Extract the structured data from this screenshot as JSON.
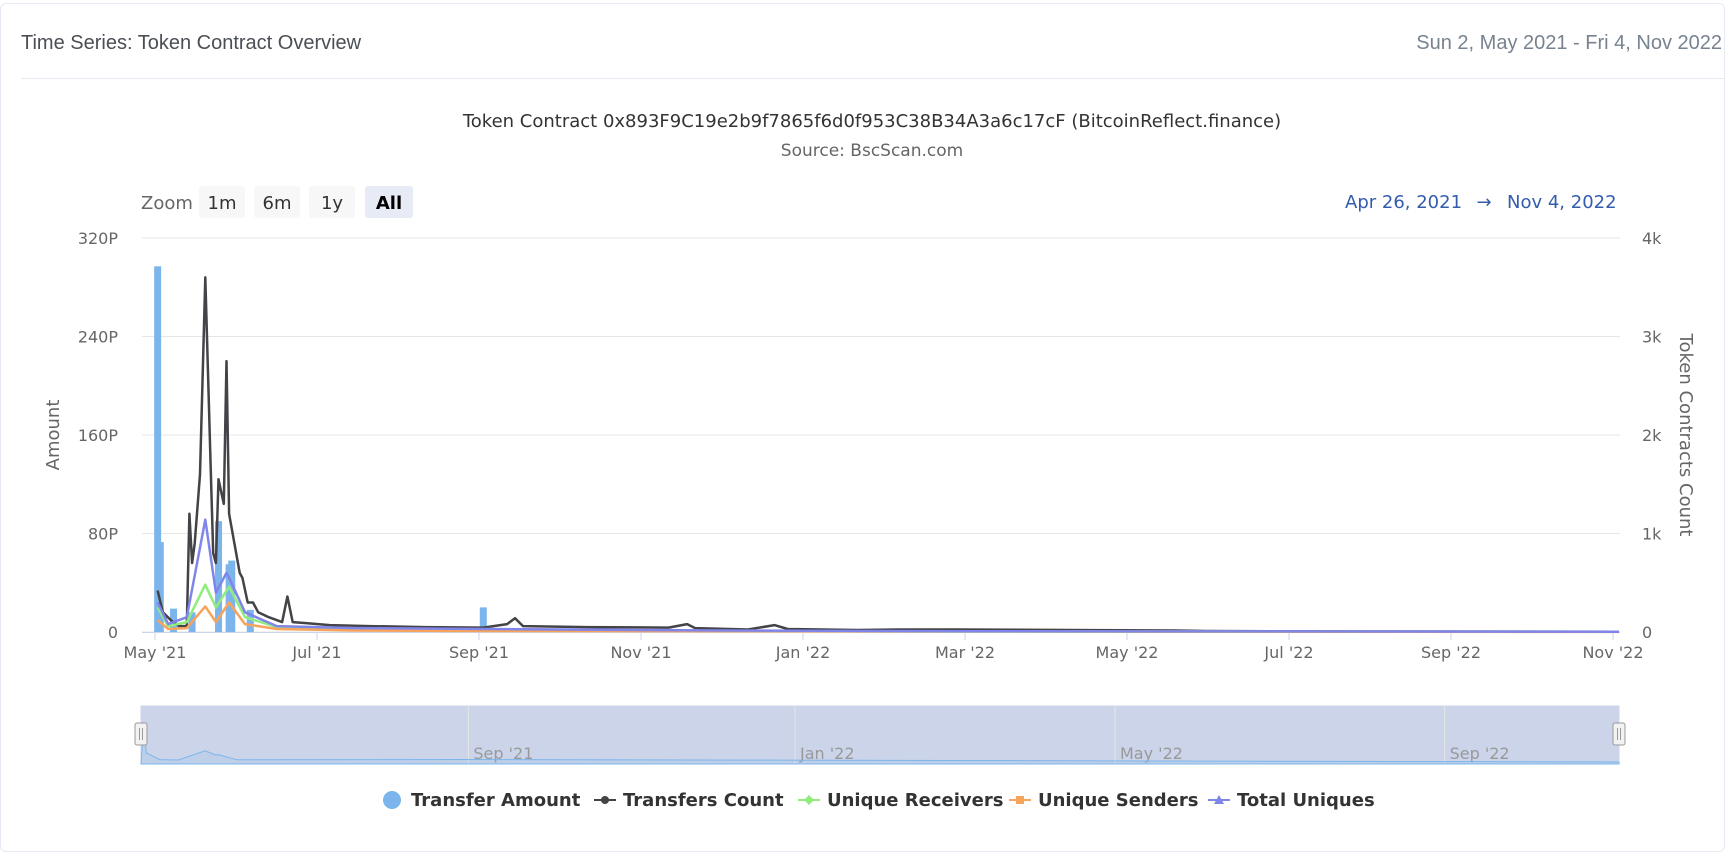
{
  "header": {
    "title": "Time Series: Token Contract Overview",
    "date_range": "Sun 2, May 2021 - Fri 4, Nov 2022"
  },
  "zoom": {
    "label": "Zoom",
    "buttons": [
      "1m",
      "6m",
      "1y",
      "All"
    ],
    "selected": "All",
    "from": "Apr 26, 2021",
    "arrow": "→",
    "to": "Nov 4, 2022"
  },
  "chart_data": {
    "type": "line",
    "title": "Token Contract 0x893F9C19e2b9f7865f6d0f953C38B34A3a6c17cF (BitcoinReflect.finance)",
    "subtitle": "Source: BscScan.com",
    "x_range": [
      "2021-04-30",
      "2022-11-04"
    ],
    "x_ticks": [
      "May '21",
      "Jul '21",
      "Sep '21",
      "Nov '21",
      "Jan '22",
      "Mar '22",
      "May '22",
      "Jul '22",
      "Sep '22",
      "Nov '22"
    ],
    "y_left": {
      "label": "Amount",
      "ticks": [
        "0",
        "80P",
        "160P",
        "240P",
        "320P"
      ],
      "range": [
        0,
        320
      ]
    },
    "y_right": {
      "label": "Token Contracts Count",
      "ticks": [
        "0",
        "1k",
        "2k",
        "3k",
        "4k"
      ],
      "range": [
        0,
        4000
      ]
    },
    "grid": true,
    "legend_position": "bottom",
    "series": [
      {
        "name": "Transfer Amount",
        "kind": "column",
        "axis": "left",
        "color": "#7cb5ec",
        "points": [
          [
            "2021-05-01",
            297
          ],
          [
            "2021-05-02",
            73
          ],
          [
            "2021-05-07",
            19
          ],
          [
            "2021-05-14",
            16
          ],
          [
            "2021-05-24",
            90
          ],
          [
            "2021-05-28",
            55
          ],
          [
            "2021-05-29",
            58
          ],
          [
            "2021-06-05",
            18
          ],
          [
            "2021-09-01",
            20
          ]
        ]
      },
      {
        "name": "Transfers Count",
        "kind": "line",
        "axis": "right",
        "color": "#434348",
        "points": [
          [
            "2021-05-01",
            420
          ],
          [
            "2021-05-03",
            200
          ],
          [
            "2021-05-06",
            120
          ],
          [
            "2021-05-09",
            60
          ],
          [
            "2021-05-12",
            60
          ],
          [
            "2021-05-13",
            1200
          ],
          [
            "2021-05-14",
            700
          ],
          [
            "2021-05-15",
            900
          ],
          [
            "2021-05-17",
            1600
          ],
          [
            "2021-05-19",
            3600
          ],
          [
            "2021-05-21",
            1700
          ],
          [
            "2021-05-22",
            800
          ],
          [
            "2021-05-23",
            700
          ],
          [
            "2021-05-24",
            1550
          ],
          [
            "2021-05-26",
            1300
          ],
          [
            "2021-05-27",
            2750
          ],
          [
            "2021-05-28",
            1200
          ],
          [
            "2021-05-30",
            900
          ],
          [
            "2021-06-01",
            600
          ],
          [
            "2021-06-02",
            550
          ],
          [
            "2021-06-04",
            300
          ],
          [
            "2021-06-06",
            300
          ],
          [
            "2021-06-08",
            200
          ],
          [
            "2021-06-12",
            150
          ],
          [
            "2021-06-17",
            100
          ],
          [
            "2021-06-19",
            360
          ],
          [
            "2021-06-21",
            100
          ],
          [
            "2021-06-26",
            90
          ],
          [
            "2021-07-05",
            70
          ],
          [
            "2021-07-20",
            60
          ],
          [
            "2021-08-10",
            50
          ],
          [
            "2021-09-01",
            45
          ],
          [
            "2021-09-10",
            80
          ],
          [
            "2021-09-13",
            140
          ],
          [
            "2021-09-16",
            60
          ],
          [
            "2021-10-10",
            50
          ],
          [
            "2021-11-10",
            45
          ],
          [
            "2021-11-17",
            80
          ],
          [
            "2021-11-20",
            40
          ],
          [
            "2021-12-10",
            25
          ],
          [
            "2021-12-20",
            70
          ],
          [
            "2021-12-25",
            30
          ],
          [
            "2022-01-20",
            20
          ],
          [
            "2022-02-05",
            25
          ],
          [
            "2022-02-25",
            25
          ],
          [
            "2022-05-20",
            15
          ],
          [
            "2022-06-01",
            10
          ],
          [
            "2022-08-01",
            5
          ],
          [
            "2022-11-04",
            3
          ]
        ]
      },
      {
        "name": "Unique Receivers",
        "kind": "line",
        "axis": "right",
        "color": "#90ed7d",
        "points": [
          [
            "2021-05-01",
            250
          ],
          [
            "2021-05-05",
            60
          ],
          [
            "2021-05-12",
            100
          ],
          [
            "2021-05-19",
            480
          ],
          [
            "2021-05-23",
            250
          ],
          [
            "2021-05-28",
            460
          ],
          [
            "2021-06-03",
            150
          ],
          [
            "2021-06-15",
            50
          ],
          [
            "2021-07-15",
            30
          ],
          [
            "2021-09-01",
            25
          ],
          [
            "2021-12-01",
            10
          ],
          [
            "2022-03-01",
            5
          ],
          [
            "2022-11-04",
            2
          ]
        ]
      },
      {
        "name": "Unique Senders",
        "kind": "line",
        "axis": "right",
        "color": "#f7a35c",
        "points": [
          [
            "2021-05-01",
            120
          ],
          [
            "2021-05-05",
            30
          ],
          [
            "2021-05-12",
            40
          ],
          [
            "2021-05-19",
            260
          ],
          [
            "2021-05-23",
            100
          ],
          [
            "2021-05-28",
            300
          ],
          [
            "2021-06-03",
            80
          ],
          [
            "2021-06-15",
            30
          ],
          [
            "2021-07-15",
            15
          ],
          [
            "2021-09-01",
            10
          ],
          [
            "2022-11-04",
            1
          ]
        ]
      },
      {
        "name": "Total Uniques",
        "kind": "line",
        "axis": "right",
        "color": "#8085e9",
        "points": [
          [
            "2021-05-01",
            300
          ],
          [
            "2021-05-05",
            80
          ],
          [
            "2021-05-12",
            150
          ],
          [
            "2021-05-19",
            1140
          ],
          [
            "2021-05-23",
            400
          ],
          [
            "2021-05-27",
            600
          ],
          [
            "2021-05-28",
            550
          ],
          [
            "2021-06-03",
            200
          ],
          [
            "2021-06-15",
            60
          ],
          [
            "2021-07-15",
            40
          ],
          [
            "2021-09-01",
            30
          ],
          [
            "2021-12-01",
            15
          ],
          [
            "2022-03-01",
            8
          ],
          [
            "2022-11-04",
            3
          ]
        ]
      }
    ],
    "navigator": {
      "labels": [
        "Sep '21",
        "Jan '22",
        "May '22",
        "Sep '22"
      ]
    }
  }
}
